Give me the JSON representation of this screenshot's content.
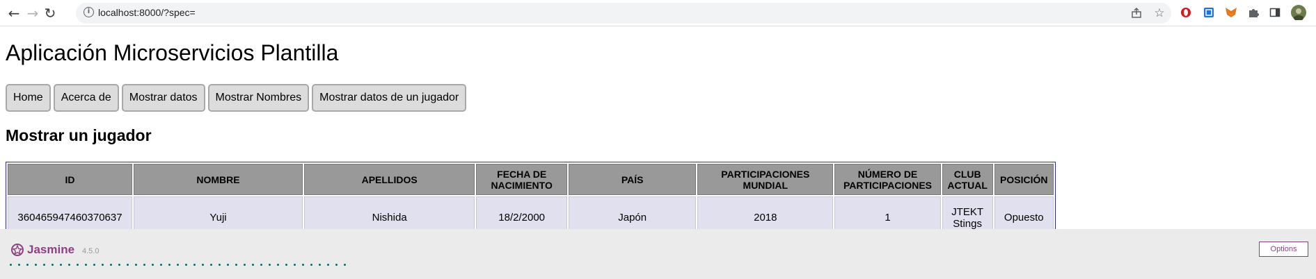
{
  "browser": {
    "url": "localhost:8000/?spec="
  },
  "page": {
    "title": "Aplicación Microservicios Plantilla",
    "menu": [
      "Home",
      "Acerca de",
      "Mostrar datos",
      "Mostrar Nombres",
      "Mostrar datos de un jugador"
    ],
    "section_title": "Mostrar un jugador"
  },
  "table": {
    "headers": [
      "ID",
      "NOMBRE",
      "APELLIDOS",
      "FECHA DE NACIMIENTO",
      "PAÍS",
      "PARTICIPACIONES MUNDIAL",
      "NÚMERO DE PARTICIPACIONES",
      "CLUB ACTUAL",
      "POSICIÓN"
    ],
    "rows": [
      [
        "360465947460370637",
        "Yuji",
        "Nishida",
        "18/2/2000",
        "Japón",
        "2018",
        "1",
        "JTEKT Stings",
        "Opuesto"
      ]
    ]
  },
  "jasmine": {
    "logo": "Jasmine",
    "version": "4.5.0",
    "options_label": "Options",
    "dot_count": 41
  },
  "colors": {
    "header_bg": "#999999",
    "row_bg": "#e0e0ee",
    "table_border": "#2a2ab0",
    "jasmine_purple": "#8a4182",
    "spec_dot": "#007069"
  }
}
